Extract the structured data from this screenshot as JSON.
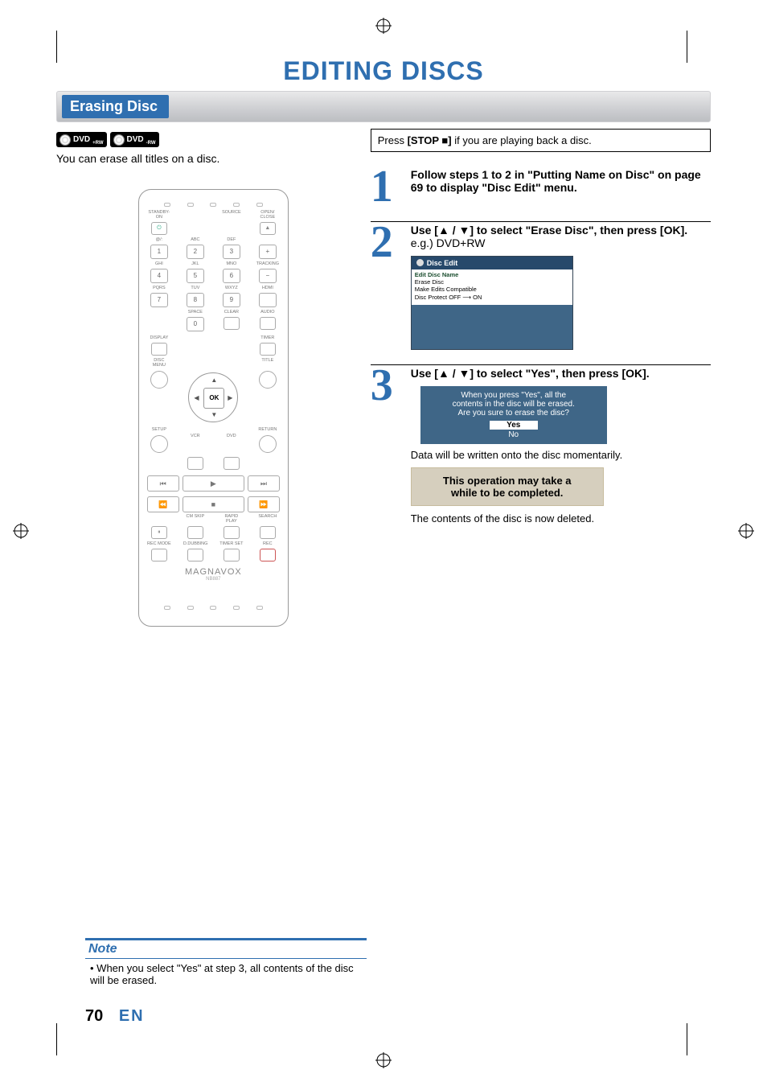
{
  "page_title": "EDITING DISCS",
  "section_header": "Erasing Disc",
  "badges": {
    "label": "DVD",
    "sub1": "+RW",
    "sub2": "-RW"
  },
  "intro": "You can erase all titles on a disc.",
  "callout": {
    "prefix": "Press ",
    "button": "[STOP ■]",
    "suffix": " if you are playing back a disc."
  },
  "steps": [
    {
      "num": "1",
      "bold_parts": [
        "Follow steps 1 to 2 in \"Putting Name on Disc\" on page 69 to display \"Disc Edit\" menu."
      ]
    },
    {
      "num": "2",
      "prefix": "Use [",
      "mid": " / ",
      "suffix": "] to select \"Erase Disc\", then press [OK].",
      "eg": "e.g.) DVD+RW",
      "menu_title": "Disc Edit",
      "menu_items": [
        "Edit Disc Name",
        "Erase Disc",
        "Make Edits Compatible",
        "Disc Protect OFF ⟶ ON"
      ]
    },
    {
      "num": "3",
      "prefix": "Use [",
      "mid": " / ",
      "suffix": "] to select \"Yes\", then press [OK].",
      "confirm_lines": [
        "When you press \"Yes\", all the",
        "contents in the disc will be erased.",
        "Are you sure to erase the disc?"
      ],
      "opt_yes": "Yes",
      "opt_no": "No",
      "after1": "Data will be written onto the disc momentarily.",
      "busy": [
        "This operation may take a",
        "while to be completed."
      ],
      "after2": "The contents of the disc is now deleted."
    }
  ],
  "remote": {
    "top_labels": [
      "STANDBY-ON",
      "",
      "SOURCE",
      "OPEN/ CLOSE"
    ],
    "num_labels": [
      [
        "@/:",
        "ABC",
        "DEF",
        ""
      ],
      [
        "1",
        "2",
        "3",
        "+"
      ],
      [
        "GHI",
        "JKL",
        "MNO",
        "TRACKING"
      ],
      [
        "4",
        "5",
        "6",
        "−"
      ],
      [
        "PQRS",
        "TUV",
        "WXYZ",
        "HDMI"
      ],
      [
        "7",
        "8",
        "9",
        ""
      ],
      [
        "",
        "SPACE",
        "CLEAR",
        "AUDIO"
      ],
      [
        "",
        "0",
        "",
        ""
      ]
    ],
    "side_labels": {
      "display": "DISPLAY",
      "timer": "TIMER",
      "disc_menu": "DISC MENU",
      "title": "TITLE",
      "setup": "SETUP",
      "return": "RETURN",
      "vcr": "VCR",
      "dvd": "DVD"
    },
    "ok": "OK",
    "bottom_labels": [
      "CM SKIP",
      "RAPID PLAY",
      "SEARCH"
    ],
    "bottom_labels2": [
      "REC MODE",
      "D.DUBBING",
      "TIMER SET",
      "REC"
    ],
    "brand": "MAGNAVOX",
    "model": "NB887"
  },
  "note": {
    "head": "Note",
    "body": "When you select \"Yes\" at step 3, all contents of the disc will be erased."
  },
  "page_number": "70",
  "page_lang": "EN"
}
